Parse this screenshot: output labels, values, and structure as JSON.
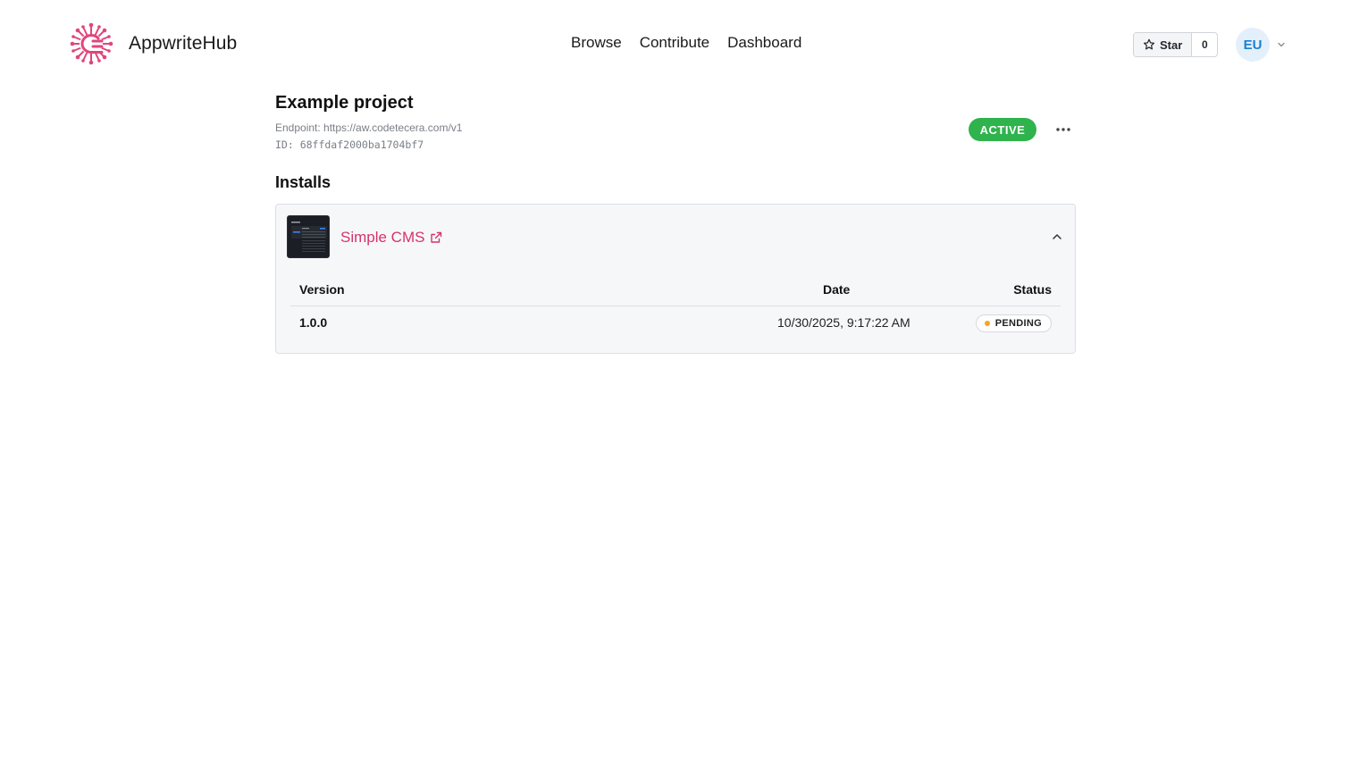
{
  "header": {
    "brand_name": "AppwriteHub",
    "nav": [
      "Browse",
      "Contribute",
      "Dashboard"
    ],
    "star_label": "Star",
    "star_count": "0",
    "avatar_initials": "EU"
  },
  "project": {
    "title": "Example project",
    "endpoint": "Endpoint: https://aw.codetecera.com/v1",
    "id": "ID: 68ffdaf2000ba1704bf7",
    "status": "ACTIVE"
  },
  "installs": {
    "heading": "Installs",
    "items": [
      {
        "app_name": "Simple CMS",
        "columns": {
          "version": "Version",
          "date": "Date",
          "status": "Status"
        },
        "rows": [
          {
            "version": "1.0.0",
            "date": "10/30/2025, 9:17:22 AM",
            "status": "PENDING"
          }
        ]
      }
    ]
  },
  "colors": {
    "brand_accent": "#d6336c",
    "active_green": "#2fb34d",
    "pending_dot": "#f5a623",
    "avatar_bg": "#e3f0fb",
    "avatar_text": "#1a7fd0"
  },
  "icons": {
    "logo": "appwritehub-logo-icon",
    "star": "star-icon",
    "chevron": "chevron-down-icon",
    "more": "more-horizontal-icon",
    "external": "external-link-icon",
    "collapse": "chevron-up-icon"
  }
}
